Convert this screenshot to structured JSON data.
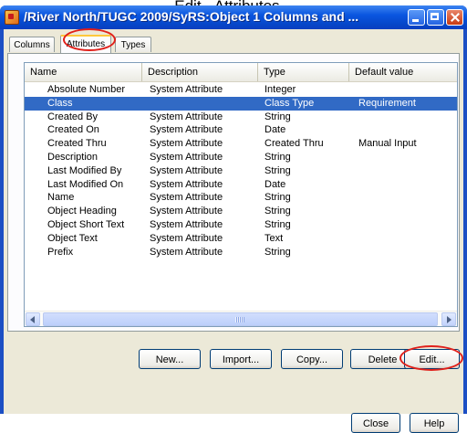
{
  "caption": "Edit - Attributes...",
  "window": {
    "title": "/River North/TUGC 2009/SyRS:Object 1 Columns and ..."
  },
  "tabs": [
    {
      "label": "Columns",
      "active": false
    },
    {
      "label": "Attributes",
      "active": true
    },
    {
      "label": "Types",
      "active": false
    }
  ],
  "list": {
    "headers": [
      "Name",
      "Description",
      "Type",
      "Default value"
    ],
    "rows": [
      {
        "name": "Absolute Number",
        "description": "System Attribute",
        "type": "Integer",
        "default": ""
      },
      {
        "name": "Class",
        "description": "",
        "type": "Class Type",
        "default": "Requirement",
        "selected": true
      },
      {
        "name": "Created By",
        "description": "System Attribute",
        "type": "String",
        "default": ""
      },
      {
        "name": "Created On",
        "description": "System Attribute",
        "type": "Date",
        "default": ""
      },
      {
        "name": "Created Thru",
        "description": "System Attribute",
        "type": "Created Thru",
        "default": "Manual Input"
      },
      {
        "name": "Description",
        "description": "System Attribute",
        "type": "String",
        "default": ""
      },
      {
        "name": "Last Modified By",
        "description": "System Attribute",
        "type": "String",
        "default": ""
      },
      {
        "name": "Last Modified On",
        "description": "System Attribute",
        "type": "Date",
        "default": ""
      },
      {
        "name": "Name",
        "description": "System Attribute",
        "type": "String",
        "default": ""
      },
      {
        "name": "Object Heading",
        "description": "System Attribute",
        "type": "String",
        "default": ""
      },
      {
        "name": "Object Short Text",
        "description": "System Attribute",
        "type": "String",
        "default": ""
      },
      {
        "name": "Object Text",
        "description": "System Attribute",
        "type": "Text",
        "default": ""
      },
      {
        "name": "Prefix",
        "description": "System Attribute",
        "type": "String",
        "default": ""
      }
    ]
  },
  "buttons": {
    "new": "New...",
    "import": "Import...",
    "copy": "Copy...",
    "delete": "Delete",
    "edit": "Edit...",
    "close": "Close",
    "help": "Help"
  },
  "colors": {
    "selection": "#316ac5",
    "annotation_circle": "#e0201a",
    "titlebar": "#0a56e0"
  }
}
